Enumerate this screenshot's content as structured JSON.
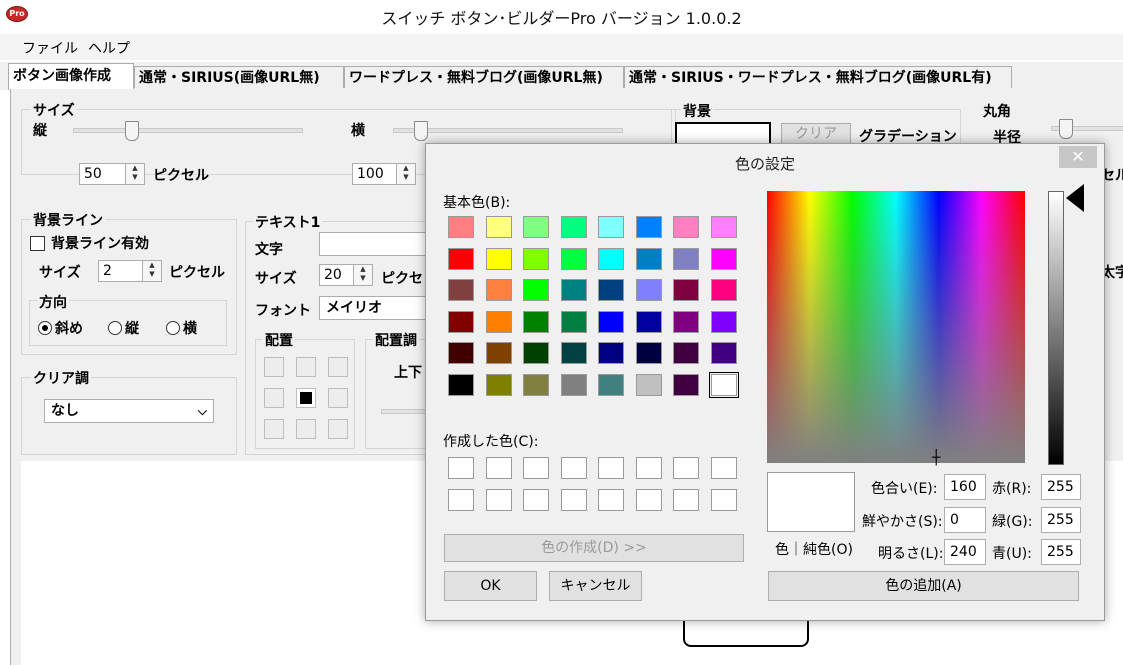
{
  "window": {
    "title": "スイッチ ボタン･ビルダーPro  バージョン 1.0.0.2",
    "icon_label": "Pro"
  },
  "menu": [
    "ファイル",
    "ヘルプ"
  ],
  "tabs": [
    "ボタン画像作成",
    "通常・SIRIUS(画像URL無)",
    "ワードプレス・無料ブログ(画像URL無)",
    "通常・SIRIUS・ワードプレス・無料ブログ(画像URL有)"
  ],
  "size": {
    "title": "サイズ",
    "height_label": "縦",
    "width_label": "横",
    "height_value": "50",
    "width_value": "100",
    "unit": "ピクセル"
  },
  "background": {
    "title": "背景",
    "clear_button": "クリア",
    "gradient_label": "グラデーション"
  },
  "corner": {
    "title": "丸角",
    "radius_label": "半径",
    "unit_partial": "セル"
  },
  "bg_line": {
    "title": "背景ライン",
    "enable_label": "背景ライン有効",
    "size_label": "サイズ",
    "size_value": "2",
    "unit": "ピクセル",
    "direction_title": "方向",
    "directions": [
      "斜め",
      "縦",
      "横"
    ],
    "selected_direction": "斜め"
  },
  "clear_tone": {
    "title": "クリア調",
    "value": "なし"
  },
  "text1": {
    "title": "テキスト1",
    "text_label": "文字",
    "text_value": "",
    "size_label": "サイズ",
    "size_value": "20",
    "unit_partial": "ピクセ",
    "font_label": "フォント",
    "font_value": "メイリオ",
    "layout_title": "配置",
    "layout_tone_title": "配置調",
    "updown_label": "上下",
    "bold_partial": "太字"
  },
  "color_dialog": {
    "title": "色の設定",
    "close_icon": "close-icon",
    "basic_colors_label": "基本色(B):",
    "basic_colors": [
      "#ff8080",
      "#ffff80",
      "#80ff80",
      "#00ff80",
      "#80ffff",
      "#0080ff",
      "#ff80c0",
      "#ff80ff",
      "#ff0000",
      "#ffff00",
      "#80ff00",
      "#00ff40",
      "#00ffff",
      "#0080c0",
      "#8080c0",
      "#ff00ff",
      "#804040",
      "#ff8040",
      "#00ff00",
      "#008080",
      "#004080",
      "#8080ff",
      "#800040",
      "#ff0080",
      "#800000",
      "#ff8000",
      "#008000",
      "#008040",
      "#0000ff",
      "#0000a0",
      "#800080",
      "#8000ff",
      "#400000",
      "#804000",
      "#004000",
      "#004040",
      "#000080",
      "#000040",
      "#400040",
      "#400080",
      "#000000",
      "#808000",
      "#808040",
      "#808080",
      "#408080",
      "#c0c0c0",
      "#400040",
      "#ffffff"
    ],
    "selected_basic_index": 47,
    "custom_colors_label": "作成した色(C):",
    "define_custom_button": "色の作成(D) >>",
    "ok_button": "OK",
    "cancel_button": "キャンセル",
    "preview_label": "色｜純色(O)",
    "hue_label": "色合い(E):",
    "hue": "160",
    "sat_label": "鮮やかさ(S):",
    "sat": "0",
    "lum_label": "明るさ(L):",
    "lum": "240",
    "red_label": "赤(R):",
    "red": "255",
    "green_label": "緑(G):",
    "green": "255",
    "blue_label": "青(U):",
    "blue": "255",
    "add_button": "色の追加(A)"
  }
}
